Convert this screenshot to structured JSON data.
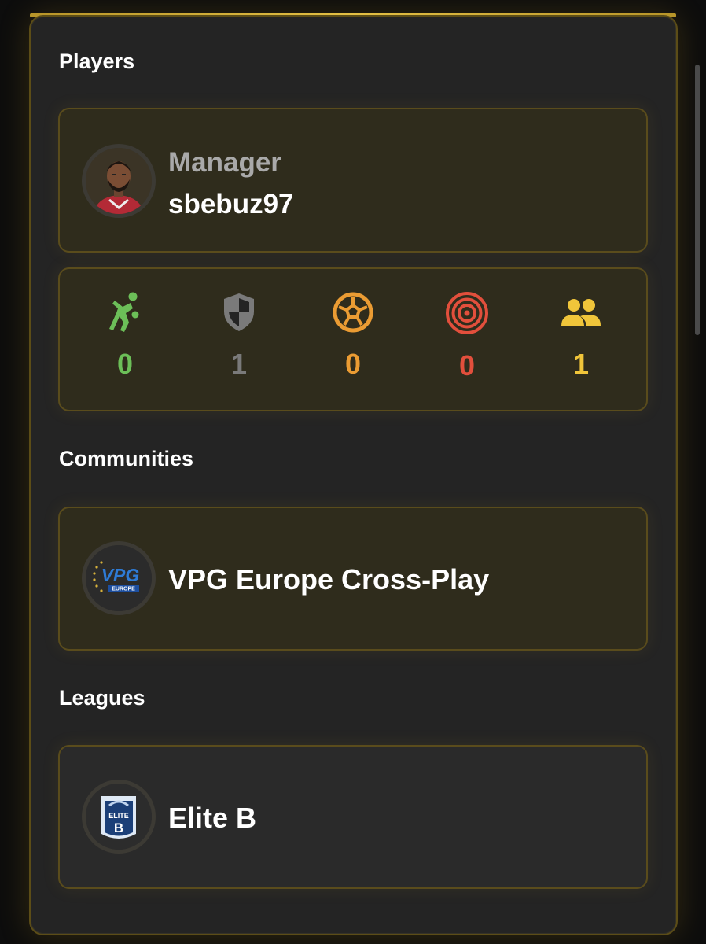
{
  "sections": {
    "players_title": "Players",
    "communities_title": "Communities",
    "leagues_title": "Leagues"
  },
  "manager": {
    "role": "Manager",
    "username": "sbebuz97",
    "avatar_icon": "player-portrait"
  },
  "stats": [
    {
      "icon": "player-running-icon",
      "value": "0",
      "color": "#6cbf58"
    },
    {
      "icon": "shield-icon",
      "value": "1",
      "color": "#7a7a7a"
    },
    {
      "icon": "soccer-ball-icon",
      "value": "0",
      "color": "#eb9c33"
    },
    {
      "icon": "target-icon",
      "value": "0",
      "color": "#e24f3c"
    },
    {
      "icon": "group-icon",
      "value": "1",
      "color": "#f0c53a"
    }
  ],
  "community": {
    "name": "VPG Europe Cross-Play",
    "logo_text": "VPG",
    "logo_subtext": "EUROPE"
  },
  "league": {
    "name": "Elite B",
    "logo_text": "ELITE",
    "logo_letter": "B"
  }
}
